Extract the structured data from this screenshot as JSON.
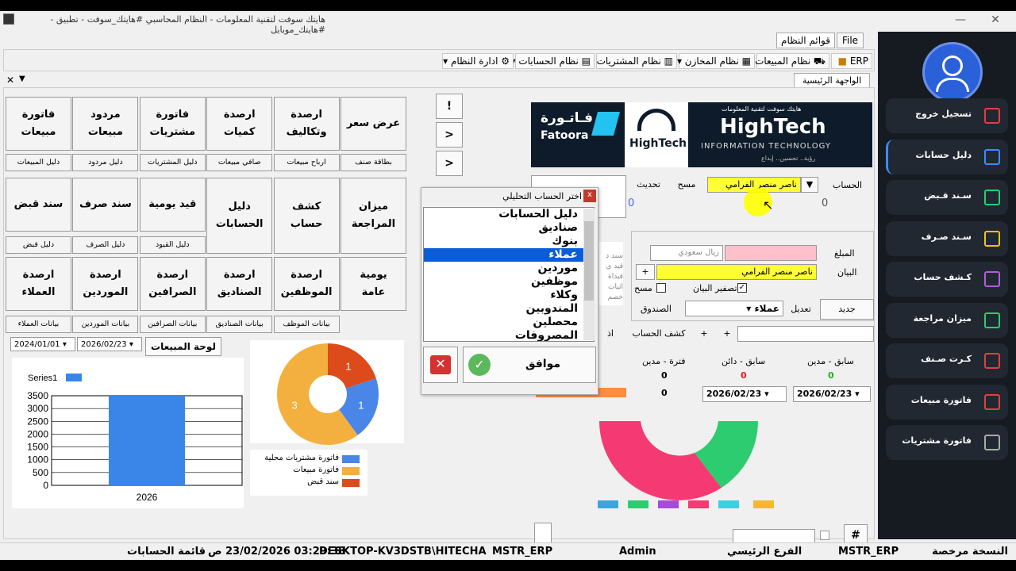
{
  "window": {
    "title": "هايتك سوفت لتقنية المعلومات - النظام المحاسبي #هايتك_سوفت - تطبيق -#هايتك_موبايل",
    "close_glyph": "✕",
    "max_glyph": "❐",
    "min_glyph": "—"
  },
  "menu_tabs": {
    "file": "File",
    "system_lists": "قوائم النظام"
  },
  "toolbar": {
    "erp": "ERP",
    "sales": "نظام المبيعات",
    "stores": "نظام المخازن",
    "purchases": "نظام المشتريات",
    "accounts": "نظام الحسابات",
    "admin": "ادارة النظام"
  },
  "page_tab": {
    "label": "الواجهة الرئيسية",
    "close": "✕"
  },
  "sidebar": {
    "items": [
      {
        "label": "تسجيل خروج",
        "color": "#e04040"
      },
      {
        "label": "دليل حسابات",
        "color": "#3d8bff"
      },
      {
        "label": "سـند قـبض",
        "color": "#2ecc71"
      },
      {
        "label": "سـند صـرف",
        "color": "#f1c40f"
      },
      {
        "label": "كـشف حساب",
        "color": "#b05fd8"
      },
      {
        "label": "ميزان مراجعة",
        "color": "#2ecc71"
      },
      {
        "label": "كـرت صـنف",
        "color": "#e04040"
      },
      {
        "label": "فاتورة مبيعات",
        "color": "#e04040"
      },
      {
        "label": "فاتورة مشتريات",
        "color": "#aaaaaa"
      }
    ]
  },
  "grid": {
    "row1": [
      "عرض سعر",
      "ارصدة\nوتكاليف",
      "ارصدة\nكميات",
      "فاتورة\nمشتريات",
      "مردود\nمبيعات",
      "فاتورة\nمبيعات"
    ],
    "row1_small": [
      "بطاقة صنف",
      "ارباح مبيعات",
      "صافي مبيعات",
      "دليل المشتريات",
      "دليل مردود",
      "دليل المبيعات"
    ],
    "row2": [
      "ميزان\nالمراجعة",
      "كشف\nحساب",
      "دليل\nالحسابات",
      "قيد يومية",
      "سند صرف",
      "سند قبض"
    ],
    "row2_small": [
      "دليل القيود",
      "دليل الصرف",
      "دليل قبض"
    ],
    "row3": [
      "يومية\nعامة",
      "ارصدة\nالموظفين",
      "ارصدة\nالصناديق",
      "ارصدة\nالصرافين",
      "ارصدة\nالموردين",
      "ارصدة\nالعملاء"
    ],
    "row3_small": [
      "بيانات الموظف",
      "بيانات الصناديق",
      "بيانات الصرافين",
      "بيانات الموردين",
      "بيانات العملاء"
    ]
  },
  "nav_buttons": [
    "!",
    ">",
    ">"
  ],
  "dashboard": {
    "date_from": "2024/01/01",
    "date_to": "2026/02/23",
    "sales_board_btn": "لوحة المبيعات"
  },
  "chart_data": [
    {
      "type": "bar",
      "categories": [
        "2026"
      ],
      "series": [
        {
          "name": "Series1",
          "values": [
            3500
          ]
        }
      ],
      "yticks": [
        0,
        500,
        1000,
        1500,
        2000,
        2500,
        3000,
        3500
      ],
      "ylim": [
        0,
        3500
      ]
    },
    {
      "type": "pie",
      "labels": [
        "فاتورة مشتريات محلية",
        "فاتورة مبيعات",
        "سند قبض"
      ],
      "values": [
        1,
        3,
        1
      ],
      "colors": [
        "#4a86e8",
        "#f4b03e",
        "#dd4a1c"
      ]
    }
  ],
  "banner": {
    "fatoora_ar": "فـاتـورة",
    "fatoora_en": "Fatoora",
    "hightech_logo": "HighTech",
    "brand": "HighTech",
    "tagline_top": "هايتك سوفت لتقنية المعلومات",
    "subtitle": "INFORMATION TECHNOLOGY",
    "tagline_bottom": "رؤية.. تحسين.. إبداع"
  },
  "account_panel": {
    "account_label": "الحساب",
    "account_value": "ناصر منصر الفرامي",
    "clear_btn": "مسح",
    "refresh_btn": "تحديث",
    "zero_left": "0",
    "zero_right": "0"
  },
  "voucher": {
    "amount_label": "المبلغ",
    "currency": "ريال سعودي",
    "statement_label": "البيان",
    "statement_value": "ناصر منصر الفرامي",
    "clear_statement": "تصفير البيان",
    "clear": "مسح",
    "type_value": "عملاء",
    "box_label": "الصندوق",
    "edit": "تعديل",
    "new": "جديد",
    "hidden_lines": [
      "سند د",
      "قيد ي",
      "قيداة",
      "اثبات",
      "خصم"
    ]
  },
  "bottom_bar": {
    "statement_btn": "كشف الحساب",
    "plus1": "+",
    "plus2": "+",
    "xx": "اذ"
  },
  "balances": {
    "prev_debit_label": "سابق - مدين",
    "prev_credit_label": "سابق - دائن",
    "period_debit_label": "فترة - مدين",
    "prev_debit_value": "0",
    "prev_credit_value": "0",
    "period_debit_value": "0",
    "period_value2": "0",
    "date1": "2026/02/23",
    "date2": "2026/02/23"
  },
  "dialog": {
    "title": "اختر الحساب التحليلي",
    "close": "x",
    "items": [
      "دليل الحسابات",
      "صناديق",
      "بنوك",
      "عملاء",
      "موردين",
      "موظفين",
      "وكلاء",
      "المندوبين",
      "محصلين",
      "المصروفات"
    ],
    "selected": 3,
    "ok": "موافق"
  },
  "footer_controls": {
    "hash": "#"
  },
  "statusbar": {
    "licensed": "النسخة مرخصة",
    "db": "MSTR_ERP",
    "branch": "الفرع الرئيسي",
    "user": "Admin",
    "db2": "MSTR_ERP",
    "machine": "DESKTOP-KV3DSTB\\HITECHA",
    "datetime": "03:29:38 23/02/2026 ص",
    "screen": "قائمة الحسابات"
  }
}
